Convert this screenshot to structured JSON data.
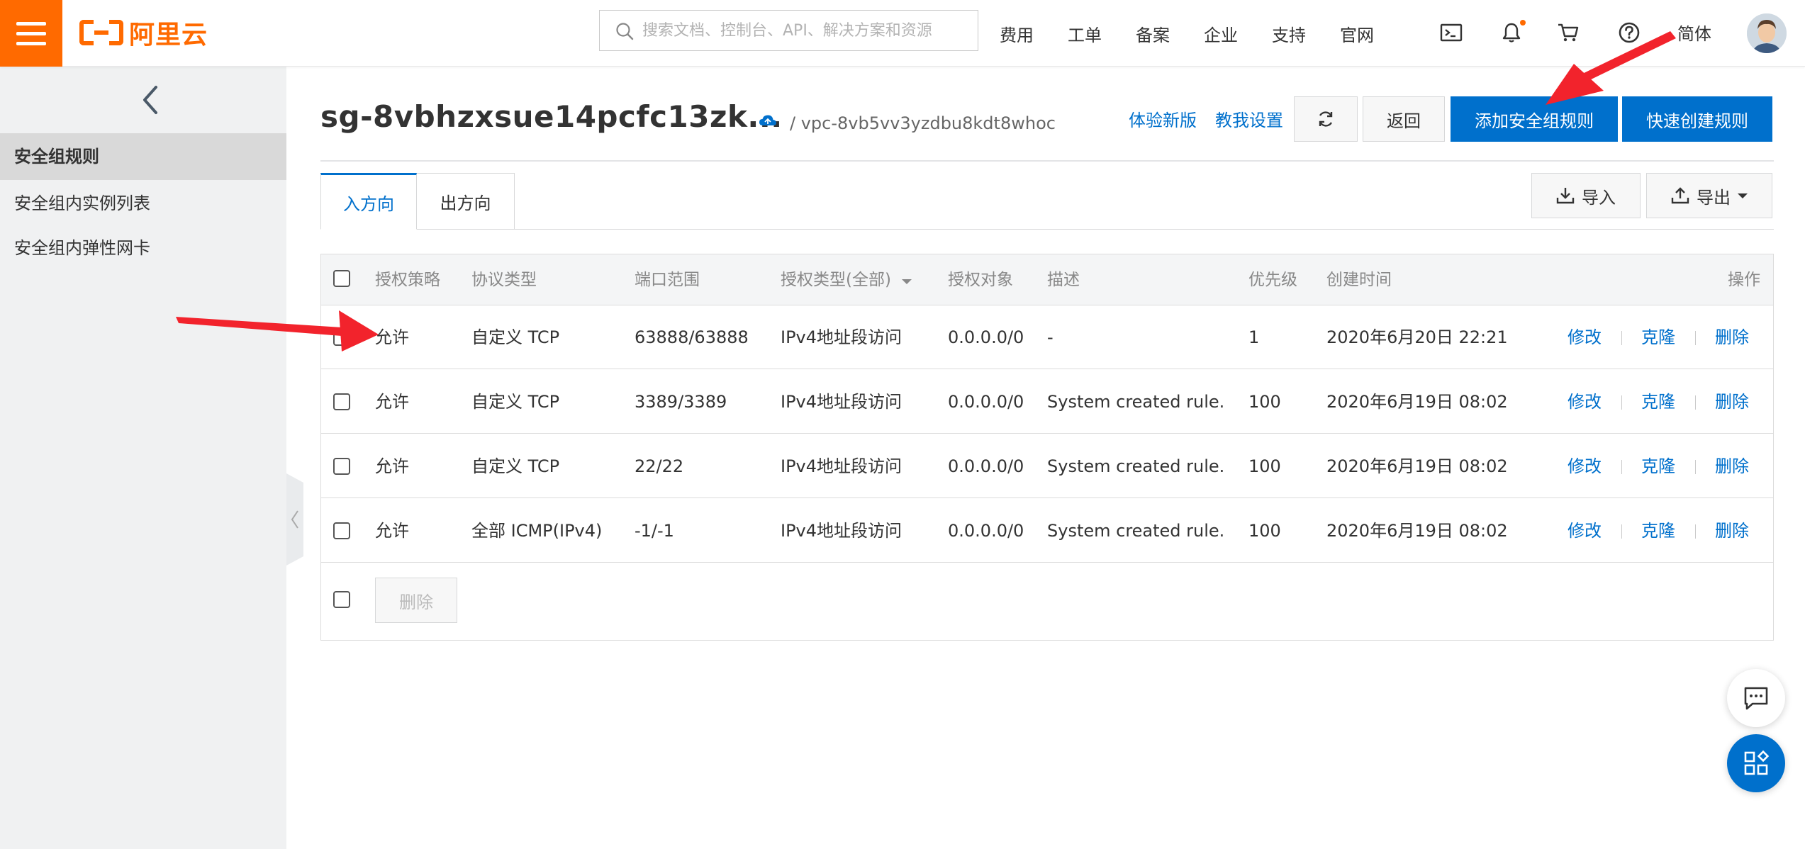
{
  "brand": {
    "logo_text": "阿里云",
    "accent": "#ff6a00",
    "primary": "#0070cc"
  },
  "search": {
    "placeholder": "搜索文档、控制台、API、解决方案和资源"
  },
  "nav": {
    "items": [
      "费用",
      "工单",
      "备案",
      "企业",
      "支持",
      "官网"
    ],
    "lang": "简体",
    "icons": [
      "terminal-icon",
      "bell-icon",
      "cart-icon",
      "help-icon"
    ]
  },
  "sidebar": {
    "items": [
      "安全组规则",
      "安全组内实例列表",
      "安全组内弹性网卡"
    ],
    "active": 0
  },
  "header": {
    "title": "sg-8vbhzxsue14pcfc13zk...",
    "vpc": "/ vpc-8vb5vv3yzdbu8kdt8whoc",
    "link_new": "体验新版",
    "link_guide": "教我设置",
    "back": "返回",
    "add_rule": "添加安全组规则",
    "quick_rule": "快速创建规则"
  },
  "tabs": [
    "入方向",
    "出方向"
  ],
  "toolbar": {
    "import": "导入",
    "export": "导出"
  },
  "table": {
    "columns": [
      "授权策略",
      "协议类型",
      "端口范围",
      "授权类型(全部)",
      "授权对象",
      "描述",
      "优先级",
      "创建时间",
      "操作"
    ],
    "rows": [
      {
        "policy": "允许",
        "protocol": "自定义 TCP",
        "port": "63888/63888",
        "auth_type": "IPv4地址段访问",
        "object": "0.0.0.0/0",
        "desc": "-",
        "priority": "1",
        "created": "2020年6月20日 22:21"
      },
      {
        "policy": "允许",
        "protocol": "自定义 TCP",
        "port": "3389/3389",
        "auth_type": "IPv4地址段访问",
        "object": "0.0.0.0/0",
        "desc": "System created rule.",
        "priority": "100",
        "created": "2020年6月19日 08:02"
      },
      {
        "policy": "允许",
        "protocol": "自定义 TCP",
        "port": "22/22",
        "auth_type": "IPv4地址段访问",
        "object": "0.0.0.0/0",
        "desc": "System created rule.",
        "priority": "100",
        "created": "2020年6月19日 08:02"
      },
      {
        "policy": "允许",
        "protocol": "全部 ICMP(IPv4)",
        "port": "-1/-1",
        "auth_type": "IPv4地址段访问",
        "object": "0.0.0.0/0",
        "desc": "System created rule.",
        "priority": "100",
        "created": "2020年6月19日 08:02"
      }
    ],
    "actions": [
      "修改",
      "克隆",
      "删除"
    ],
    "bulk_delete": "删除"
  }
}
